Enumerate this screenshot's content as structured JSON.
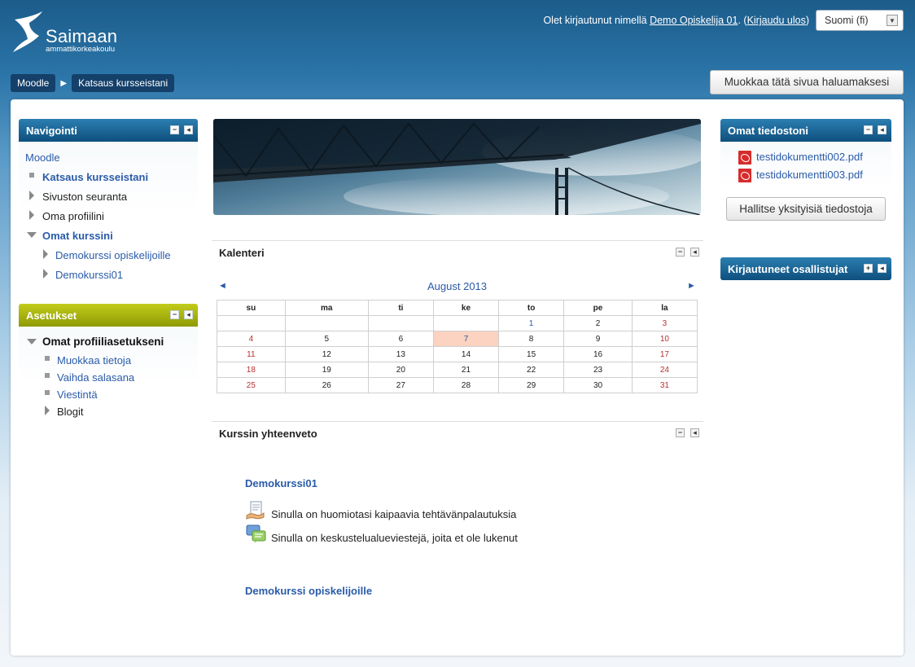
{
  "header": {
    "logo_name": "Saimaan",
    "logo_sub": "ammattikorkeakoulu",
    "login_prefix": "Olet kirjautunut nimellä ",
    "user_name": "Demo Opiskelija 01",
    "logout_open": ". (",
    "logout_label": "Kirjaudu ulos",
    "logout_close": ")",
    "language": "Suomi (fi)"
  },
  "breadcrumb": [
    "Moodle",
    "Katsaus kursseistani"
  ],
  "edit_button": "Muokkaa tätä sivua haluamaksesi",
  "navigation": {
    "title": "Navigointi",
    "items": [
      "Moodle",
      "Katsaus kursseistani",
      "Sivuston seuranta",
      "Oma profiilini",
      "Omat kurssini",
      "Demokurssi opiskelijoille",
      "Demokurssi01"
    ]
  },
  "settings": {
    "title": "Asetukset",
    "items": [
      "Omat profiiliasetukseni",
      "Muokkaa tietoja",
      "Vaihda salasana",
      "Viestintä",
      "Blogit"
    ]
  },
  "calendar": {
    "title": "Kalenteri",
    "month": "August 2013",
    "prev": "◄",
    "next": "►",
    "days": [
      "su",
      "ma",
      "ti",
      "ke",
      "to",
      "pe",
      "la"
    ],
    "weeks": [
      [
        "",
        "",
        "",
        "",
        "1",
        "2",
        "3"
      ],
      [
        "4",
        "5",
        "6",
        "7",
        "8",
        "9",
        "10"
      ],
      [
        "11",
        "12",
        "13",
        "14",
        "15",
        "16",
        "17"
      ],
      [
        "18",
        "19",
        "20",
        "21",
        "22",
        "23",
        "24"
      ],
      [
        "25",
        "26",
        "27",
        "28",
        "29",
        "30",
        "31"
      ]
    ],
    "today": "7",
    "event_day": "1"
  },
  "course_overview": {
    "title": "Kurssin yhteenveto",
    "courses": [
      {
        "name": "Demokurssi01",
        "notices": [
          "Sinulla on huomiotasi kaipaavia tehtävänpalautuksia",
          "Sinulla on keskustelualueviestejä, joita et ole lukenut"
        ]
      },
      {
        "name": "Demokurssi opiskelijoille",
        "notices": []
      }
    ]
  },
  "private_files": {
    "title": "Omat tiedostoni",
    "files": [
      "testidokumentti002.pdf",
      "testidokumentti003.pdf"
    ],
    "manage_button": "Hallitse yksityisiä tiedostoja"
  },
  "online_users": {
    "title": "Kirjautuneet osallistujat"
  },
  "colors": {
    "header_blue": "#1c5c8a",
    "block_blue": "#0f4f7d",
    "block_green": "#8e9a05",
    "link": "#2a5ba8",
    "today_highlight": "#fcd2c0",
    "weekend": "#b83030"
  }
}
